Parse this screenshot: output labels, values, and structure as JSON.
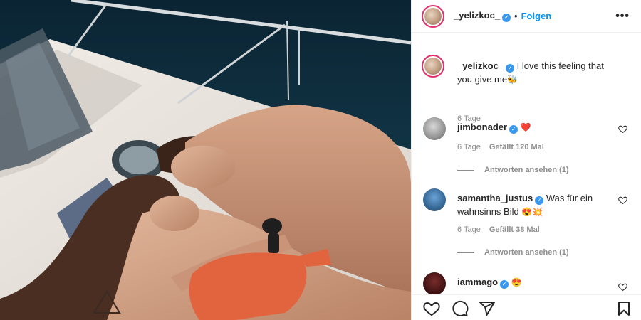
{
  "post": {
    "username": "_yelizkoc_",
    "verified": true,
    "separator": "•",
    "follow_label": "Folgen",
    "more_label": "•••"
  },
  "caption": {
    "username": "_yelizkoc_",
    "text": "I love this feeling that you give me",
    "emoji": "🐝",
    "time": "6 Tage"
  },
  "comments": [
    {
      "username": "jimbonader",
      "text": "",
      "emoji": "❤️",
      "time": "6 Tage",
      "likes": "Gefällt 120 Mal",
      "replies": "Antworten ansehen (1)"
    },
    {
      "username": "samantha_justus",
      "text": "Was für ein wahnsinns Bild",
      "emoji": "😍💥",
      "time": "6 Tage",
      "likes": "Gefällt 38 Mal",
      "replies": "Antworten ansehen (1)"
    },
    {
      "username": "iammago",
      "text": "",
      "emoji": "😍"
    }
  ],
  "icons": {
    "like": "heart-icon",
    "comment": "comment-icon",
    "share": "share-icon",
    "save": "bookmark-icon",
    "verified": "verified-badge-icon",
    "comment_like": "heart-outline-icon"
  },
  "colors": {
    "follow": "#0095f6",
    "verified": "#3897f0",
    "story_ring": "#e1306c",
    "muted": "#8e8e8e"
  }
}
